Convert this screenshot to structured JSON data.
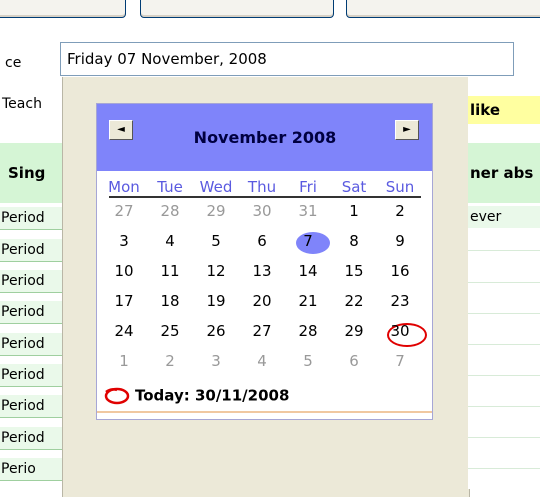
{
  "form": {
    "date_label_partial": "ce",
    "teacher_label_partial": "Teach",
    "date_value": "Friday 07 November, 2008",
    "single_label_partial": "Sing",
    "right_header_partial": "like",
    "right_header2_partial": "ner abs",
    "right_cell_partial": "ever"
  },
  "grid": {
    "rows": [
      "Period",
      "Period",
      "Period",
      "Period",
      "Period",
      "Period",
      "Period",
      "Period",
      "Perio"
    ]
  },
  "calendar": {
    "prev_label": "◄",
    "next_label": "►",
    "month_title": "November 2008",
    "weekdays": [
      "Mon",
      "Tue",
      "Wed",
      "Thu",
      "Fri",
      "Sat",
      "Sun"
    ],
    "weeks": [
      [
        {
          "d": "27",
          "o": true
        },
        {
          "d": "28",
          "o": true
        },
        {
          "d": "29",
          "o": true
        },
        {
          "d": "30",
          "o": true
        },
        {
          "d": "31",
          "o": true
        },
        {
          "d": "1",
          "o": false
        },
        {
          "d": "2",
          "o": false
        }
      ],
      [
        {
          "d": "3",
          "o": false
        },
        {
          "d": "4",
          "o": false
        },
        {
          "d": "5",
          "o": false
        },
        {
          "d": "6",
          "o": false
        },
        {
          "d": "7",
          "o": false
        },
        {
          "d": "8",
          "o": false
        },
        {
          "d": "9",
          "o": false
        }
      ],
      [
        {
          "d": "10",
          "o": false
        },
        {
          "d": "11",
          "o": false
        },
        {
          "d": "12",
          "o": false
        },
        {
          "d": "13",
          "o": false
        },
        {
          "d": "14",
          "o": false
        },
        {
          "d": "15",
          "o": false
        },
        {
          "d": "16",
          "o": false
        }
      ],
      [
        {
          "d": "17",
          "o": false
        },
        {
          "d": "18",
          "o": false
        },
        {
          "d": "19",
          "o": false
        },
        {
          "d": "20",
          "o": false
        },
        {
          "d": "21",
          "o": false
        },
        {
          "d": "22",
          "o": false
        },
        {
          "d": "23",
          "o": false
        }
      ],
      [
        {
          "d": "24",
          "o": false
        },
        {
          "d": "25",
          "o": false
        },
        {
          "d": "26",
          "o": false
        },
        {
          "d": "27",
          "o": false
        },
        {
          "d": "28",
          "o": false
        },
        {
          "d": "29",
          "o": false
        },
        {
          "d": "30",
          "o": false
        }
      ],
      [
        {
          "d": "1",
          "o": true
        },
        {
          "d": "2",
          "o": true
        },
        {
          "d": "3",
          "o": true
        },
        {
          "d": "4",
          "o": true
        },
        {
          "d": "5",
          "o": true
        },
        {
          "d": "6",
          "o": true
        },
        {
          "d": "7",
          "o": true
        }
      ]
    ],
    "selected_day": "7",
    "today_day": "30",
    "today_text": "Today: 30/11/2008"
  },
  "colors": {
    "header_bg": "#7f84fa",
    "weekday_text": "#5a5ae0",
    "today_marker": "#e00000",
    "grid_green": "#eaf9ea",
    "highlight_yellow": "#ffffa0"
  }
}
